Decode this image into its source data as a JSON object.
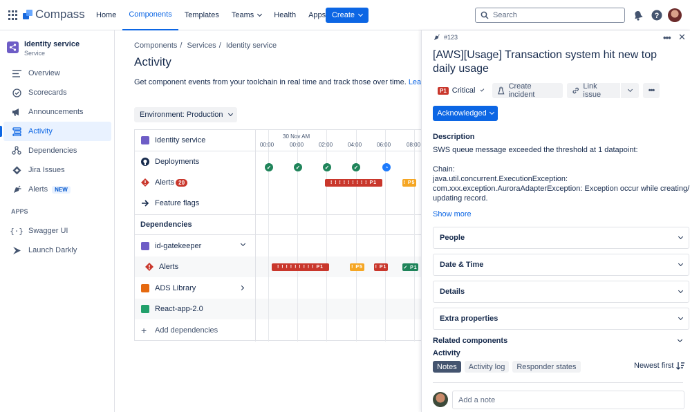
{
  "app": {
    "name": "Compass",
    "colors": {
      "accent": "#0c66e4",
      "critical": "#c9372c",
      "success": "#1f845a",
      "warning": "#f5a623",
      "purple": "#6e5dc6"
    }
  },
  "nav": {
    "items": [
      "Home",
      "Components",
      "Templates",
      "Teams",
      "Health",
      "Apps"
    ],
    "active": "Components",
    "create_label": "Create"
  },
  "search": {
    "placeholder": "Search"
  },
  "sidebar": {
    "service_name": "Identity service",
    "service_type": "Service",
    "items": [
      {
        "label": "Overview",
        "icon": "overview-icon"
      },
      {
        "label": "Scorecards",
        "icon": "scorecard-icon"
      },
      {
        "label": "Announcements",
        "icon": "megaphone-icon"
      },
      {
        "label": "Activity",
        "icon": "activity-icon",
        "active": true
      },
      {
        "label": "Dependencies",
        "icon": "dependencies-icon"
      },
      {
        "label": "Jira Issues",
        "icon": "jira-icon"
      },
      {
        "label": "Alerts",
        "icon": "alert-icon",
        "badge": "NEW"
      }
    ],
    "apps_title": "APPS",
    "apps": [
      {
        "label": "Swagger UI",
        "icon": "code-icon"
      },
      {
        "label": "Launch Darkly",
        "icon": "launch-darkly-icon"
      }
    ]
  },
  "main": {
    "breadcrumbs": [
      "Components",
      "Services",
      "Identity service"
    ],
    "title": "Activity",
    "description": "Get component events from your toolchain in real time and track those over time.",
    "learn_more": "Learn mo",
    "environment": "Environment: Production"
  },
  "timeline": {
    "date_label": "30 Nov AM",
    "times": [
      "00:00",
      "00:00",
      "02:00",
      "04:00",
      "06:00",
      "08:00"
    ],
    "header_row": "Identity service",
    "rows": {
      "deployments": "Deployments",
      "alerts": "Alerts",
      "alerts_count": "20",
      "feature_flags": "Feature flags",
      "dependencies_title": "Dependencies",
      "id_gatekeeper": "id-gatekeeper",
      "dep_alerts": "Alerts",
      "ads_library": "ADS Library",
      "react_app": "React-app-2.0",
      "add_dependencies": "Add dependencies"
    },
    "alert_labels": {
      "row1_long": "! ! ! ! ! ! ! ! ! P1",
      "row1_p5": "! P5",
      "row2_long": "! ! ! ! ! ! ! ! ! P1",
      "row2_p5": "! P5",
      "row2_p1": "! P1",
      "row2_p1_ok": "✓ P1"
    }
  },
  "panel": {
    "id": "#123",
    "title": "[AWS][Usage] Transaction system hit new top daily usage",
    "priority_badge": "P1",
    "priority_label": "Critical",
    "create_incident": "Create incident",
    "link_issue": "Link issue",
    "status": "Acknowledged",
    "description_title": "Description",
    "description_lines": [
      "SWS queue message exceeded the threshold at 1 datapoint:",
      "",
      "Chain:",
      "java.util.concurrent.ExecutionException:",
      "com.xxx.exception.AuroraAdapterException: Exception occur while creating/",
      "updating record."
    ],
    "show_more": "Show more",
    "sections": [
      "People",
      "Date & Time",
      "Details",
      "Extra properties"
    ],
    "related_components": "Related components",
    "activity_title": "Activity",
    "tabs": [
      "Notes",
      "Activity log",
      "Responder states"
    ],
    "sort_label": "Newest first",
    "note_placeholder": "Add a note"
  }
}
